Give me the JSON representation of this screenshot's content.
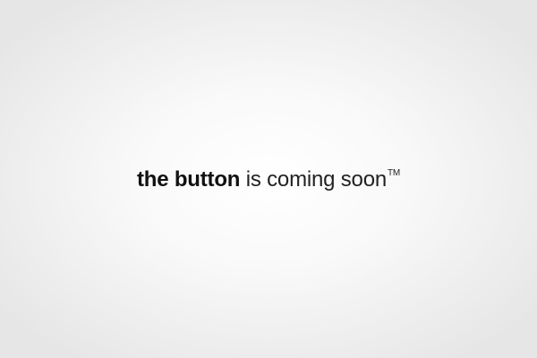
{
  "splash": {
    "headline_bold": "the button",
    "headline_rest": "is coming soon",
    "trademark": "TM"
  },
  "colors": {
    "background_center": "#ffffff",
    "background_edge": "#e6e6e6",
    "text": "#1a1a1a"
  }
}
